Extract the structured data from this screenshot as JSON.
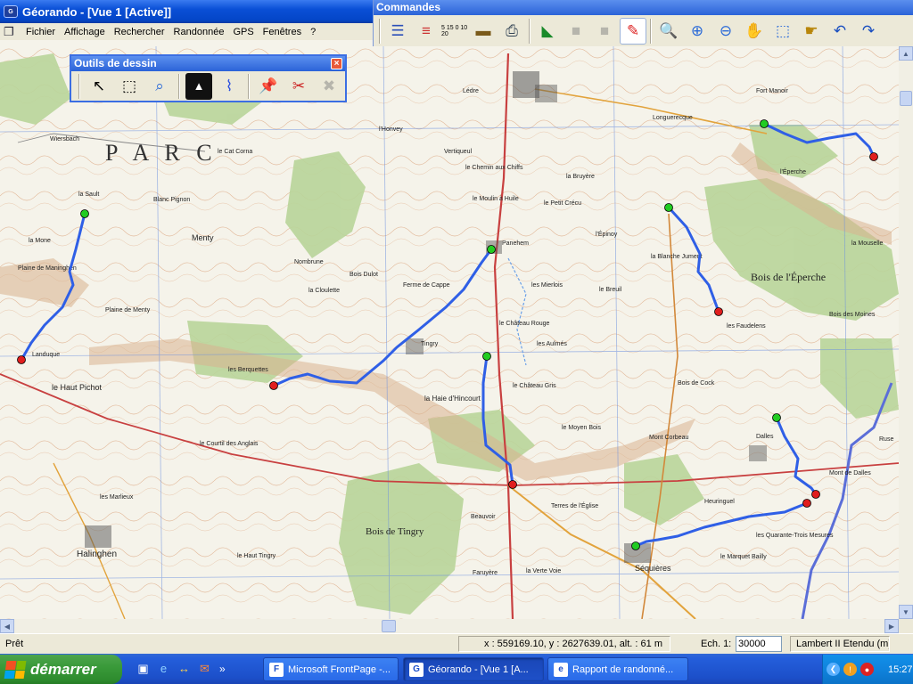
{
  "window": {
    "title": "Géorando - [Vue 1 [Active]]"
  },
  "menu": [
    "Fichier",
    "Affichage",
    "Rechercher",
    "Randonnée",
    "GPS",
    "Fenêtres",
    "?"
  ],
  "commandes": {
    "title": "Commandes",
    "scale_icon_text": "5 15 0 10 20"
  },
  "drawing_tools": {
    "title": "Outils de dessin",
    "close": "×"
  },
  "map": {
    "parc_text": "P A R C",
    "bois_eperche": "Bois de l'Éperche",
    "bois_tingry": "Bois de Tingry",
    "places": [
      {
        "name": "Lédre"
      },
      {
        "name": "Longuerecque"
      },
      {
        "name": "Fort Manoir"
      },
      {
        "name": "l'Honvey"
      },
      {
        "name": "Wiersbach"
      },
      {
        "name": "la Sault"
      },
      {
        "name": "Blanc Pignon"
      },
      {
        "name": "le Cat Corna"
      },
      {
        "name": "Menty"
      },
      {
        "name": "Nombrune"
      },
      {
        "name": "Plaine de Menty"
      },
      {
        "name": "la Mone"
      },
      {
        "name": "Plaine de Maninghen"
      },
      {
        "name": "Landuque"
      },
      {
        "name": "le Haut Pichot"
      },
      {
        "name": "les Berquettes"
      },
      {
        "name": "la Cloulette"
      },
      {
        "name": "Bois Dulot"
      },
      {
        "name": "Tingry"
      },
      {
        "name": "la Haie d'Hincourt"
      },
      {
        "name": "Panehem"
      },
      {
        "name": "le Château Rouge"
      },
      {
        "name": "le Château Gris"
      },
      {
        "name": "le Moyen Bois"
      },
      {
        "name": "les Aulmés"
      },
      {
        "name": "le Breuil"
      },
      {
        "name": "les Mierlois"
      },
      {
        "name": "la Blanche Jument"
      },
      {
        "name": "l'Épinoy"
      },
      {
        "name": "le Petit Crécu"
      },
      {
        "name": "la Bruyère"
      },
      {
        "name": "Ferme de Cappe"
      },
      {
        "name": "le Chemin aux Chiffs"
      },
      {
        "name": "le Moulin à Huile"
      },
      {
        "name": "le Courtil des Anglais"
      },
      {
        "name": "Halinghen"
      },
      {
        "name": "le Haut Tingry"
      },
      {
        "name": "les Marlieux"
      },
      {
        "name": "Beauvoir"
      },
      {
        "name": "Faruyère"
      },
      {
        "name": "la Verte Voie"
      },
      {
        "name": "Séquières"
      },
      {
        "name": "les Quarante-Trois Mesures"
      },
      {
        "name": "le Marquet Bailly"
      },
      {
        "name": "Heuringuel"
      },
      {
        "name": "les Faudelens"
      },
      {
        "name": "Dalles"
      },
      {
        "name": "Mont Corbeau"
      },
      {
        "name": "Bois des Moines"
      },
      {
        "name": "la Mouselle"
      },
      {
        "name": "l'Éperche"
      },
      {
        "name": "Terres de l'Église"
      },
      {
        "name": "Vertiqueul"
      },
      {
        "name": "Mont de Dalles"
      },
      {
        "name": "Ruse"
      },
      {
        "name": "Bois de Cock"
      }
    ]
  },
  "status": {
    "ready": "Prêt",
    "coords": "x : 559169.10, y : 2627639.01, alt. : 61 m",
    "scale_label": "Ech. 1:",
    "scale_value": "30000",
    "projection": "Lambert II Etendu (m)"
  },
  "taskbar": {
    "start": "démarrer",
    "tasks": [
      {
        "label": "Microsoft FrontPage -..."
      },
      {
        "label": "Géorando - [Vue 1 [A..."
      },
      {
        "label": "Rapport de randonné..."
      }
    ],
    "clock": "15:27"
  },
  "colors": {
    "route": "#2f5fe6",
    "waypoint_start": "#22cc22",
    "waypoint_end": "#e01e1e",
    "titlebar": "#0a4fd6"
  }
}
